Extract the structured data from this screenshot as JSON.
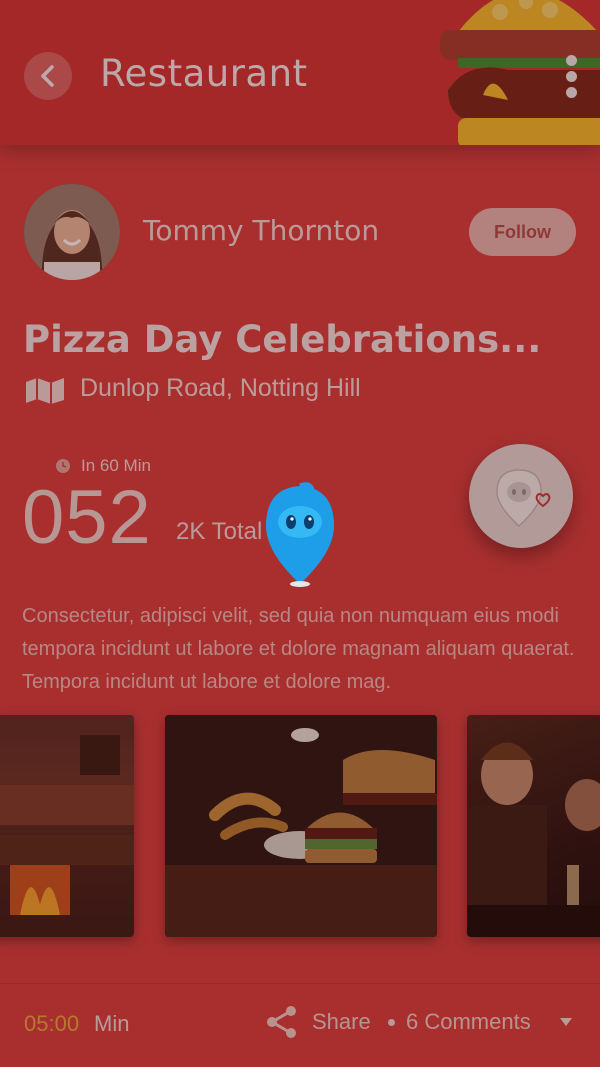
{
  "header": {
    "title": "Restaurant",
    "back_icon": "chevron-left-icon",
    "more_icon": "more-vertical-icon"
  },
  "author": {
    "name": "Tommy Thornton",
    "follow_label": "Follow"
  },
  "event": {
    "title": "Pizza Day Celebrations...",
    "location": "Dunlop Road, Notting Hill",
    "time_label": "In 60 Min",
    "count": "052",
    "count_label": "2K Total Visits"
  },
  "description": "Consectetur, adipisci velit, sed quia non numquam eius modi tempora incidunt ut labore et dolore magnam aliquam quaerat. Tempora incidunt ut labore et dolore mag.",
  "footer": {
    "timer": "05:00",
    "timer_unit": "Min",
    "share_label": "Share",
    "comments_label": "6 Comments"
  },
  "colors": {
    "primary": "#d83b3b",
    "accent_timer": "#e8a63a",
    "mascot": "#1e9ee8"
  }
}
